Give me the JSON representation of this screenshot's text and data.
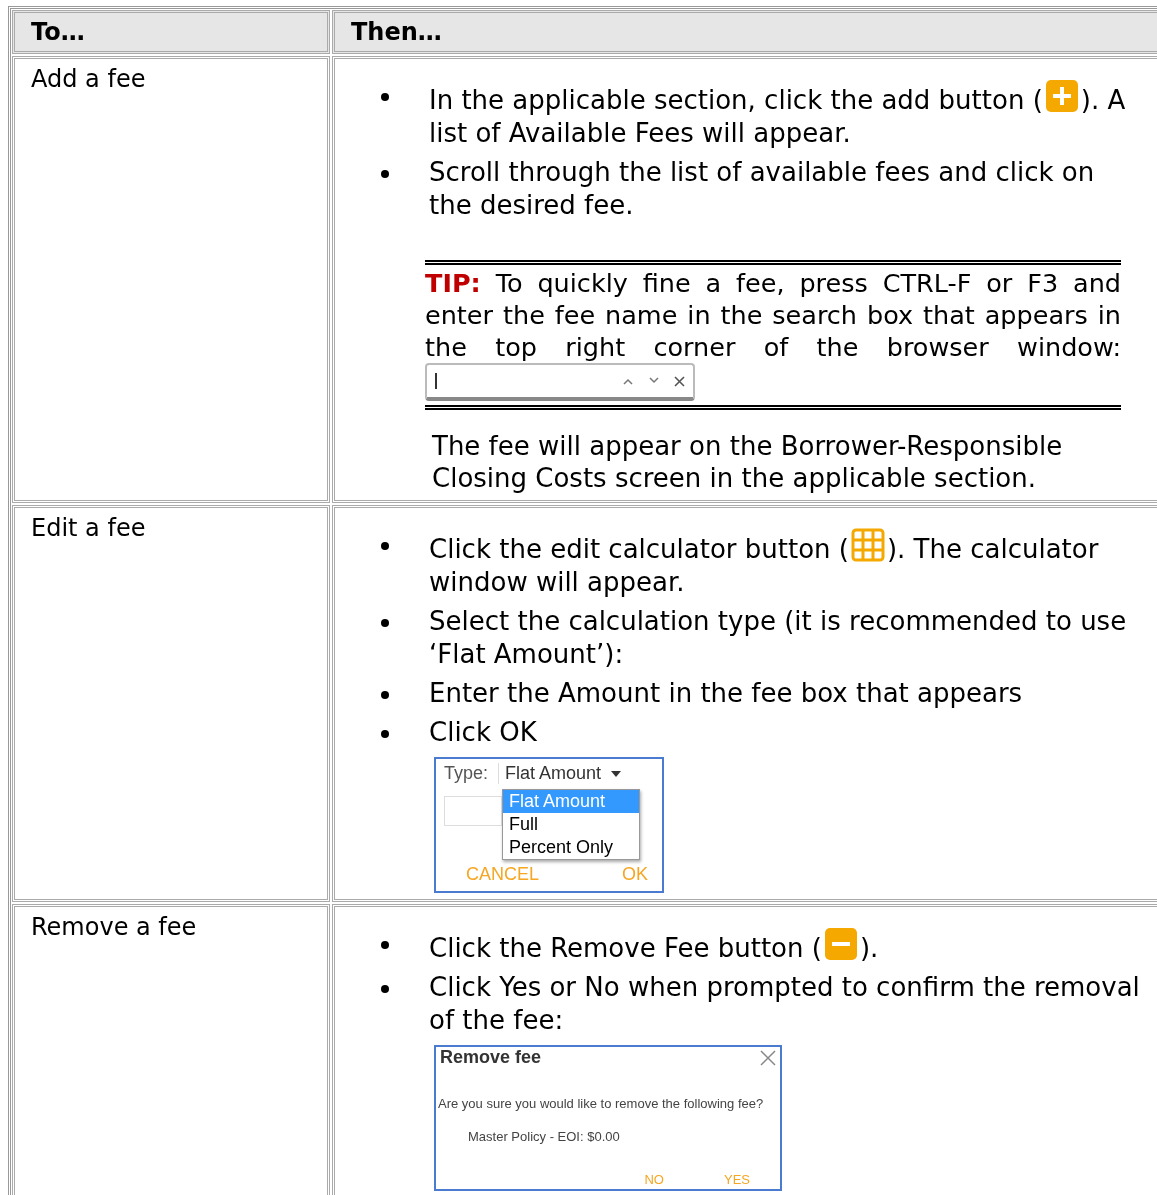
{
  "table": {
    "columns": [
      "To…",
      "Then…"
    ],
    "rows": [
      {
        "task": "Add a fee",
        "blocks": [
          {
            "kind": "steps",
            "items": [
              {
                "kind": "add",
                "before": "In the applicable section, click the add button (",
                "after": "). A list of Available Fees will appear."
              },
              {
                "kind": "plain",
                "before": "Scroll through the list of available fees and click on the desired fee."
              }
            ]
          },
          {
            "kind": "tip",
            "label": "TIP:",
            "text": "To quickly fine a fee, press CTRL-F or F3 and enter the fee name in the search box that appears in the top right corner of the browser window:",
            "find_bar": true
          },
          {
            "kind": "note",
            "text": "The fee will appear on the Borrower-Responsible Closing Costs screen in the applicable section."
          }
        ]
      },
      {
        "task": "Edit a fee",
        "blocks": [
          {
            "kind": "steps",
            "items": [
              {
                "kind": "calculator",
                "before": "Click the edit calculator button (",
                "after": "). The calculator window will appear."
              },
              {
                "kind": "plain",
                "before": "Select the calculation type (it is recommended to use ‘Flat Amount’):"
              },
              {
                "kind": "plain",
                "before": "Enter the Amount in the fee box that appears"
              },
              {
                "kind": "plain",
                "before": "Click OK"
              }
            ]
          },
          {
            "kind": "type_dialog",
            "label": "Type:",
            "value": "Flat Amount",
            "options": [
              {
                "label": "Flat Amount",
                "selected": true
              },
              {
                "label": "Full",
                "selected": false
              },
              {
                "label": "Percent Only",
                "selected": false
              }
            ],
            "buttons": [
              "CANCEL",
              "OK"
            ]
          }
        ]
      },
      {
        "task": "Remove a fee",
        "blocks": [
          {
            "kind": "steps",
            "items": [
              {
                "kind": "remove",
                "before": "Click the Remove Fee button (",
                "after": ")."
              },
              {
                "kind": "plain",
                "before": "Click Yes or No when prompted to confirm the removal of the fee:"
              }
            ]
          },
          {
            "kind": "confirm_dialog",
            "title": "Remove fee",
            "message": "Are you sure you would like to remove the following fee?",
            "item": "Master Policy - EOI: $0.00",
            "buttons": [
              "NO",
              "YES"
            ]
          }
        ]
      }
    ]
  }
}
